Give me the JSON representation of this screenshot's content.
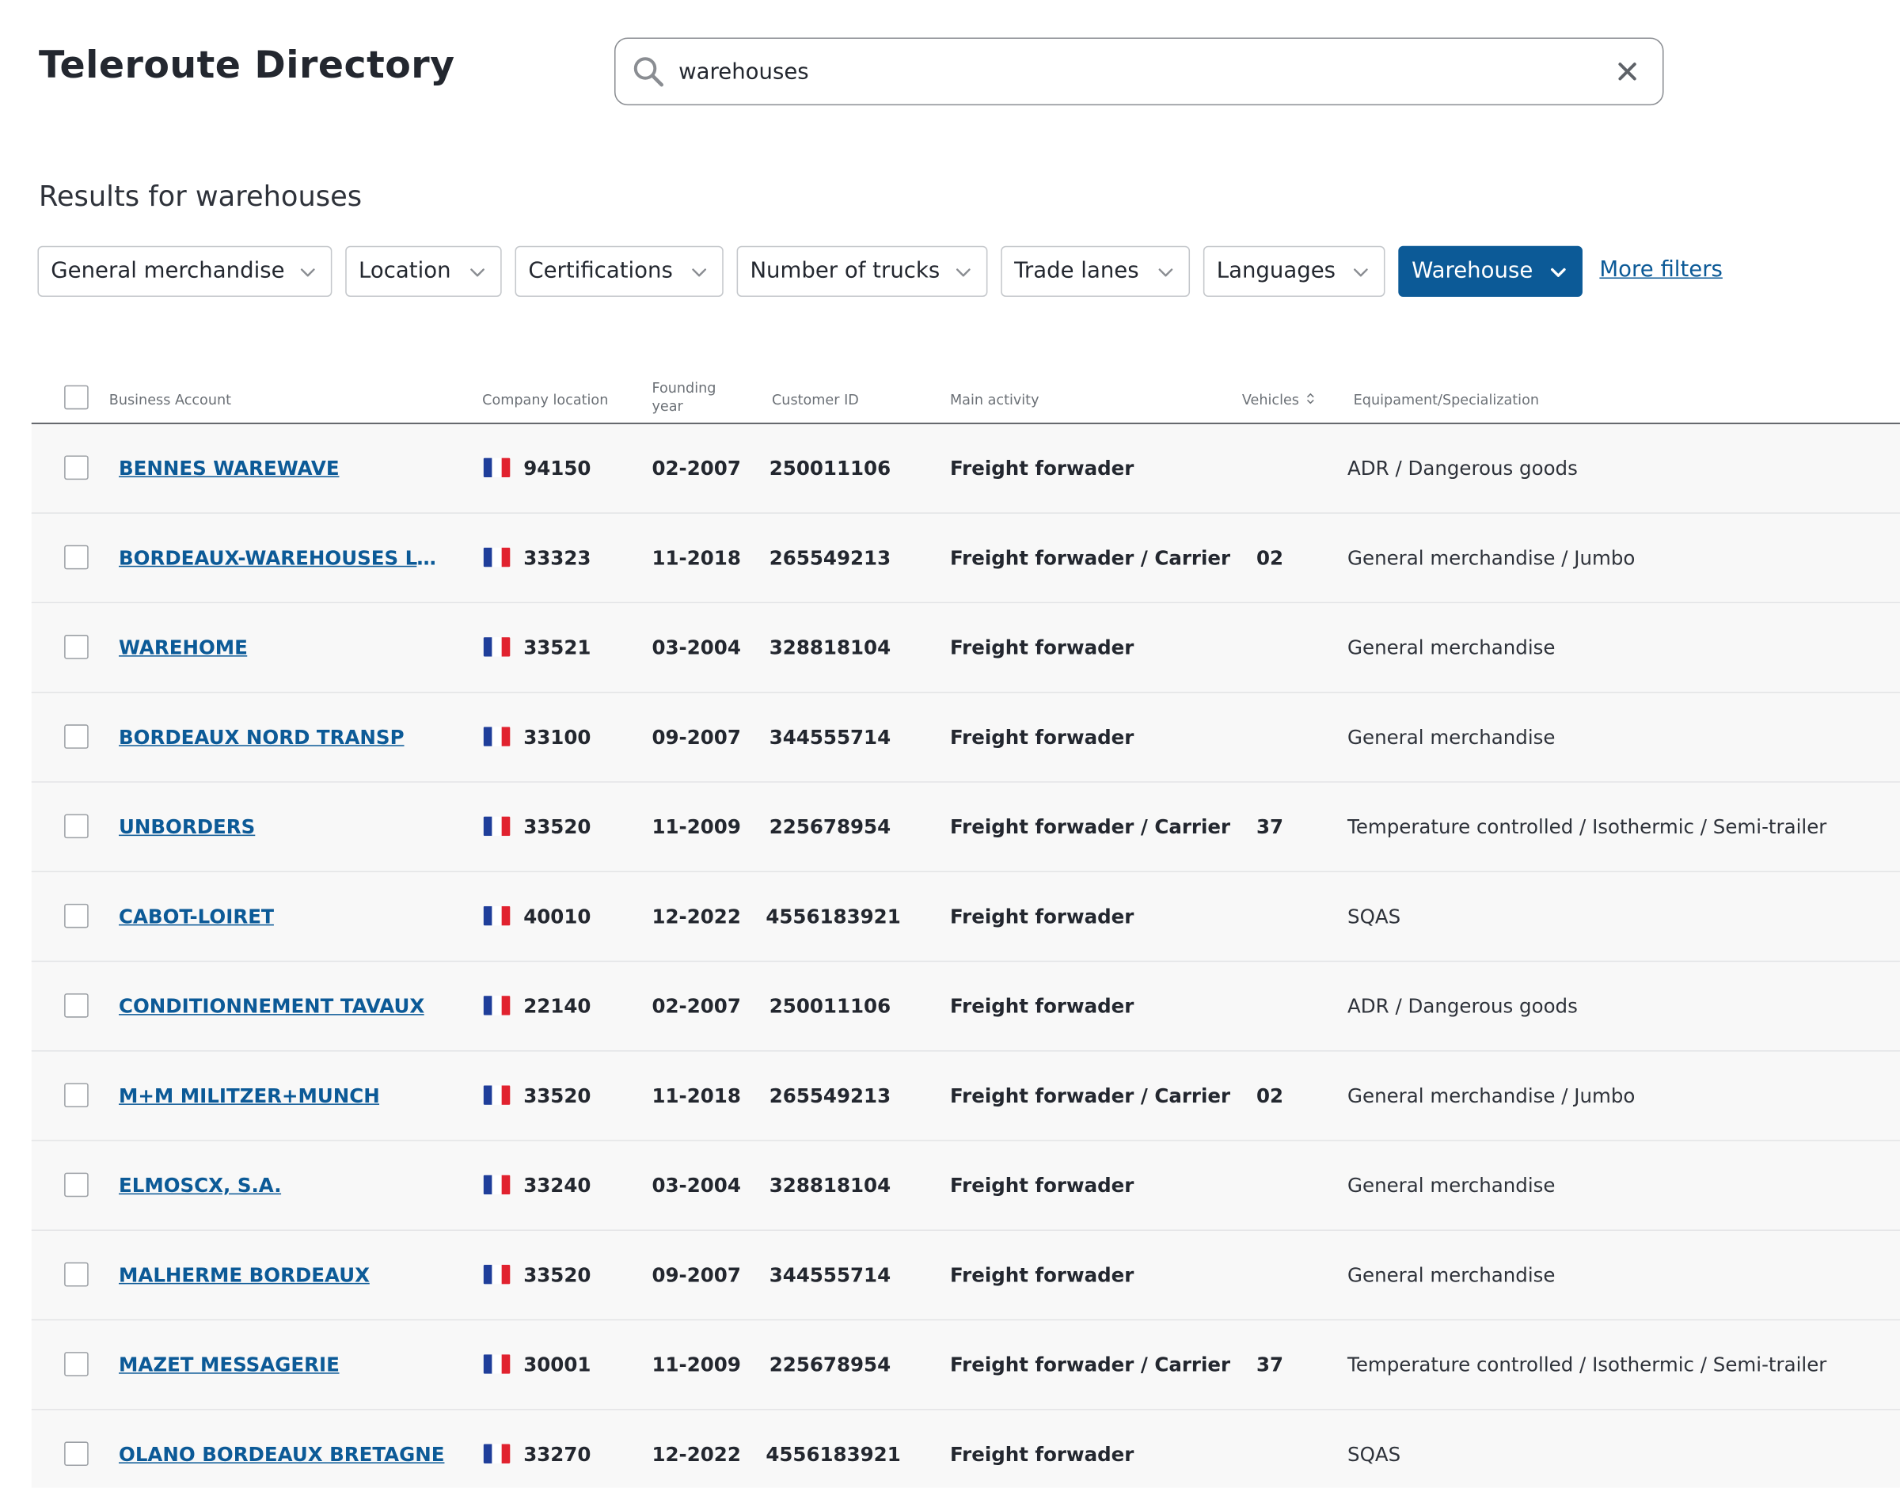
{
  "header": {
    "title": "Teleroute Directory"
  },
  "search": {
    "value": "warehouses",
    "placeholder": ""
  },
  "results": {
    "heading": "Results for warehouses"
  },
  "filters": [
    {
      "label": "General merchandise",
      "active": false
    },
    {
      "label": "Location",
      "active": false
    },
    {
      "label": "Certifications",
      "active": false
    },
    {
      "label": "Number of trucks",
      "active": false
    },
    {
      "label": "Trade lanes",
      "active": false
    },
    {
      "label": "Languages",
      "active": false
    },
    {
      "label": "Warehouse",
      "active": true
    }
  ],
  "more_filters_label": "More filters",
  "colors": {
    "accent": "#0c5a97",
    "flag_blue": "#1f3e9a",
    "flag_white": "#ffffff",
    "flag_red": "#e1222f"
  },
  "table": {
    "columns": {
      "business_account": "Business Account",
      "company_location": "Company location",
      "founding_year_line1": "Founding",
      "founding_year_line2": "year",
      "customer_id": "Customer ID",
      "main_activity": "Main activity",
      "vehicles": "Vehicles",
      "equipment": "Equipament/Specialization"
    },
    "rows": [
      {
        "name": "BENNES WAREWAVE",
        "country": "FR",
        "zip": "94150",
        "founded": "02-2007",
        "customer_id": "250011106",
        "activity": "Freight forwader",
        "vehicles": "",
        "specialization": "ADR / Dangerous goods"
      },
      {
        "name": "BORDEAUX-WAREHOUSES LOGI...",
        "country": "FR",
        "zip": "33323",
        "founded": "11-2018",
        "customer_id": "265549213",
        "activity": "Freight forwader / Carrier",
        "vehicles": "02",
        "specialization": "General merchandise / Jumbo"
      },
      {
        "name": "WAREHOME",
        "country": "FR",
        "zip": "33521",
        "founded": "03-2004",
        "customer_id": "328818104",
        "activity": "Freight forwader",
        "vehicles": "",
        "specialization": "General merchandise"
      },
      {
        "name": "BORDEAUX NORD TRANSP",
        "country": "FR",
        "zip": "33100",
        "founded": "09-2007",
        "customer_id": "344555714",
        "activity": "Freight forwader",
        "vehicles": "",
        "specialization": "General merchandise"
      },
      {
        "name": "UNBORDERS",
        "country": "FR",
        "zip": "33520",
        "founded": "11-2009",
        "customer_id": "225678954",
        "activity": "Freight forwader / Carrier",
        "vehicles": "37",
        "specialization": "Temperature controlled / Isothermic / Semi-trailer"
      },
      {
        "name": "CABOT-LOIRET",
        "country": "FR",
        "zip": "40010",
        "founded": "12-2022",
        "customer_id": "4556183921",
        "activity": "Freight forwader",
        "vehicles": "",
        "specialization": "SQAS"
      },
      {
        "name": "CONDITIONNEMENT TAVAUX",
        "country": "FR",
        "zip": "22140",
        "founded": "02-2007",
        "customer_id": "250011106",
        "activity": "Freight forwader",
        "vehicles": "",
        "specialization": "ADR / Dangerous goods"
      },
      {
        "name": "M+M MILITZER+MUNCH",
        "country": "FR",
        "zip": "33520",
        "founded": "11-2018",
        "customer_id": "265549213",
        "activity": "Freight forwader / Carrier",
        "vehicles": "02",
        "specialization": "General merchandise / Jumbo"
      },
      {
        "name": "ELMOSCX, S.A.",
        "country": "FR",
        "zip": "33240",
        "founded": "03-2004",
        "customer_id": "328818104",
        "activity": "Freight forwader",
        "vehicles": "",
        "specialization": "General merchandise"
      },
      {
        "name": "MALHERME BORDEAUX",
        "country": "FR",
        "zip": "33520",
        "founded": "09-2007",
        "customer_id": "344555714",
        "activity": "Freight forwader",
        "vehicles": "",
        "specialization": "General merchandise"
      },
      {
        "name": "MAZET MESSAGERIE",
        "country": "FR",
        "zip": "30001",
        "founded": "11-2009",
        "customer_id": "225678954",
        "activity": "Freight forwader / Carrier",
        "vehicles": "37",
        "specialization": "Temperature controlled / Isothermic / Semi-trailer"
      },
      {
        "name": "OLANO BORDEAUX BRETAGNE",
        "country": "FR",
        "zip": "33270",
        "founded": "12-2022",
        "customer_id": "4556183921",
        "activity": "Freight forwader",
        "vehicles": "",
        "specialization": "SQAS"
      }
    ]
  }
}
